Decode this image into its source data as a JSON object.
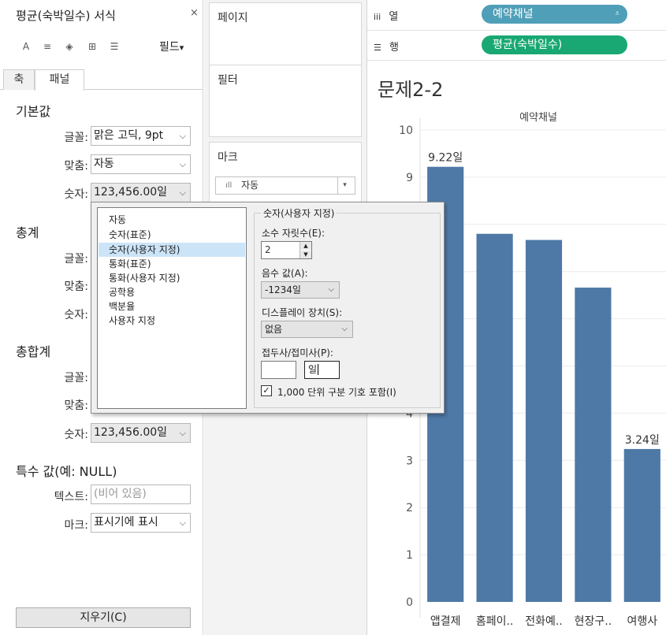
{
  "format_pane": {
    "title": "평균(숙박일수) 서식",
    "close": "×",
    "toolbar": {
      "icons": [
        {
          "name": "font-icon",
          "glyph": "A"
        },
        {
          "name": "alignment-icon",
          "glyph": "≡"
        },
        {
          "name": "shading-icon",
          "glyph": "◈"
        },
        {
          "name": "borders-icon",
          "glyph": "⊞"
        },
        {
          "name": "lines-icon",
          "glyph": "☰"
        }
      ],
      "fields_label": "필드",
      "fields_arrow": "▾"
    },
    "tabs": [
      "축",
      "패널"
    ],
    "default_section": {
      "heading": "기본값",
      "font_label": "글꼴:",
      "font_value": "맑은 고딕, 9pt",
      "align_label": "맞춤:",
      "align_value": "자동",
      "number_label": "숫자:",
      "number_value": "123,456.00일"
    },
    "totals_section": {
      "heading": "총계",
      "font_label": "글꼴:",
      "align_label": "맞춤:",
      "number_label": "숫자:"
    },
    "grand_totals_section": {
      "heading": "총합계",
      "font_label": "글꼴:",
      "align_label": "맞춤:",
      "number_label": "숫자:",
      "number_value": "123,456.00일"
    },
    "special_values": {
      "heading": "특수 값(예: NULL)",
      "text_label": "텍스트:",
      "text_placeholder": "(비어 있음)",
      "marks_label": "마크:",
      "marks_value": "표시기에 표시"
    },
    "clear_button": "지우기(C)",
    "chevron": "⌵"
  },
  "shelves": {
    "pages_title": "페이지",
    "filters_title": "필터",
    "marks_title": "마크",
    "marks_type": "자동",
    "marks_icon": "ıll",
    "marks_chevron": "▾",
    "columns_icon": "iii",
    "columns_label": "열",
    "columns_pill": "예약채널",
    "columns_pill_sort_icon": "⩡",
    "rows_icon": "☰",
    "rows_label": "행",
    "rows_pill": "평균(숙박일수)"
  },
  "colors": {
    "columns_pill": "#4f9fb8",
    "rows_pill": "#19a873",
    "bar": "#4e79a7",
    "grid": "#ececec"
  },
  "chart_data": {
    "type": "bar",
    "title": "문제2-2",
    "column_header": "예약채널",
    "categories": [
      "앱결제",
      "홈페이..",
      "전화예..",
      "현장구..",
      "여행사"
    ],
    "values": [
      9.22,
      7.8,
      7.67,
      6.66,
      3.24
    ],
    "data_labels": [
      "9.22일",
      "",
      "",
      "",
      "3.24일"
    ],
    "y_ticks": [
      "0",
      "1",
      "2",
      "3",
      "4",
      "5",
      "6",
      "7",
      "8",
      "9",
      "10"
    ],
    "ylim": [
      0,
      10
    ],
    "grid": true
  },
  "popup": {
    "formats": [
      "자동",
      "숫자(표준)",
      "숫자(사용자 지정)",
      "통화(표준)",
      "통화(사용자 지정)",
      "공학용",
      "백분율",
      "사용자 지정"
    ],
    "selected_index": 2,
    "group_title": "숫자(사용자 지정)",
    "decimal_label": "소수 자릿수(E):",
    "decimal_value": "2",
    "spin_up": "▲",
    "spin_down": "▼",
    "negative_label": "음수 값(A):",
    "negative_value": "-1234일",
    "display_units_label": "디스플레이 장치(S):",
    "display_units_value": "없음",
    "prefix_suffix_label": "접두사/접미사(P):",
    "prefix_value": "",
    "suffix_value": "일",
    "thousands_label": "1,000 단위 구분 기호 포함(I)",
    "thousands_checked": "✓",
    "chevron": "⌵"
  }
}
